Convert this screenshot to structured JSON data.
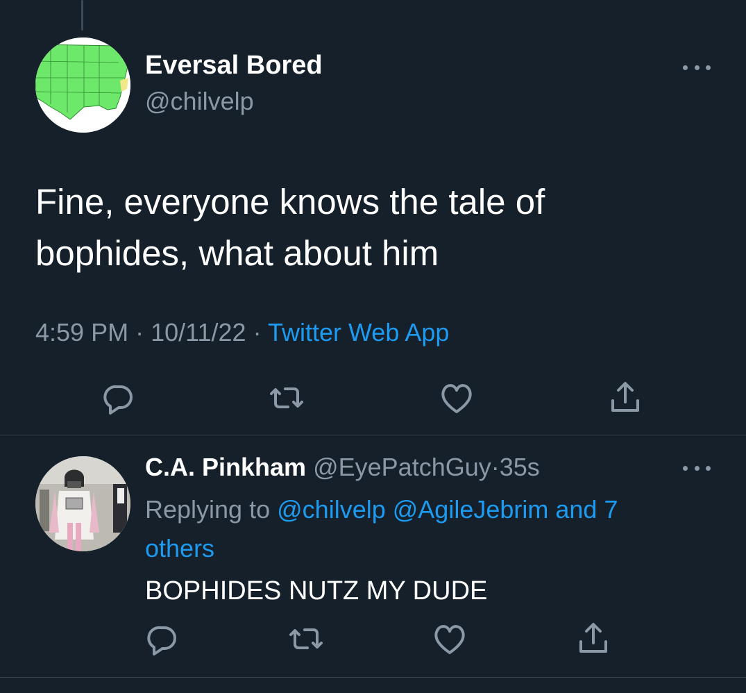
{
  "main_tweet": {
    "author_name": "Eversal Bored",
    "author_handle": "@chilvelp",
    "text_line1": "Fine, everyone knows the tale of",
    "text_line2": "bophides, what about him",
    "time": "4:59 PM",
    "separator": "·",
    "date": "10/11/22",
    "source": "Twitter Web App",
    "avatar_icon": "us-map-avatar"
  },
  "reply_tweet": {
    "author_name": "C.A. Pinkham",
    "author_handle": "@EyePatchGuy",
    "separator": "·",
    "time_ago": "35s",
    "replying_prefix": "Replying to",
    "mention1": "@chilvelp",
    "mention2": "@AgileJebrim",
    "mention_tail": "and 7 others",
    "text": "BOPHIDES NUTZ MY DUDE",
    "avatar_icon": "pink-vader-avatar"
  },
  "actions": [
    "reply-icon",
    "retweet-icon",
    "like-icon",
    "share-icon"
  ],
  "colors": {
    "background": "#15202b",
    "text": "#ffffff",
    "muted": "#8b98a5",
    "accent": "#1d9bf0",
    "divider": "#38444d"
  }
}
